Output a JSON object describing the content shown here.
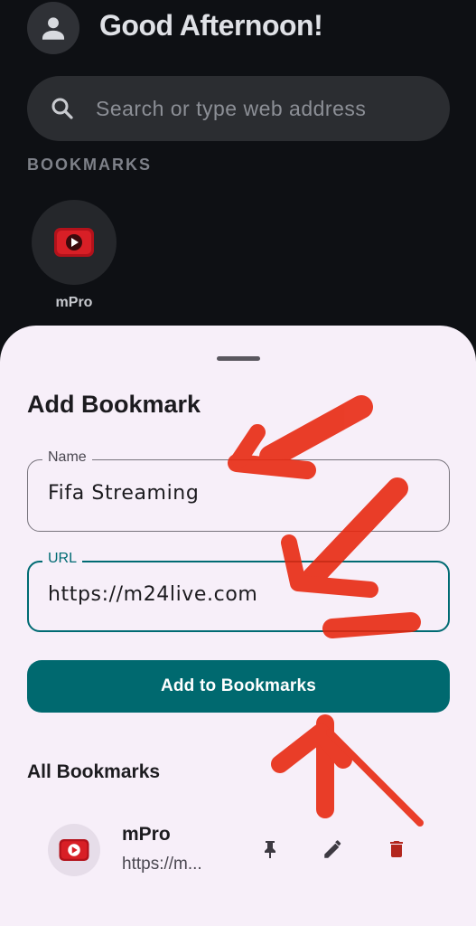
{
  "header": {
    "greeting": "Good Afternoon!"
  },
  "search": {
    "placeholder": "Search or type web address",
    "icon": "search-icon"
  },
  "bookmarks_section": {
    "label": "BOOKMARKS",
    "items": [
      {
        "label": "mPro",
        "icon": "youtube-play-icon"
      }
    ]
  },
  "sheet": {
    "title": "Add Bookmark",
    "name_field": {
      "label": "Name",
      "value": "Fifa Streaming"
    },
    "url_field": {
      "label": "URL",
      "value": "https://m24live.com"
    },
    "submit_label": "Add to Bookmarks",
    "all_bookmarks_title": "All Bookmarks",
    "list": [
      {
        "name": "mPro",
        "url": "https://m...",
        "icon": "youtube-play-icon"
      }
    ]
  },
  "colors": {
    "background": "#0e1014",
    "sheet": "#f7eff9",
    "accent": "#00696f",
    "delete": "#b3261e",
    "annotation": "#e8250c"
  }
}
